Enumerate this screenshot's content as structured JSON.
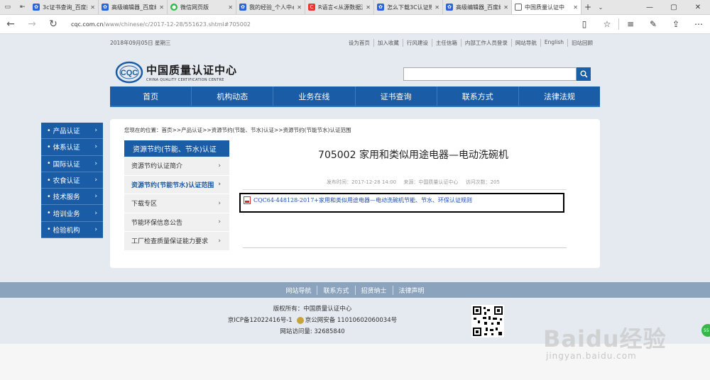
{
  "browser": {
    "tabs": [
      {
        "label": "3c证书查询_百度搜",
        "icon": "paw-icon",
        "active": false
      },
      {
        "label": "高级编辑器_百度经",
        "icon": "paw-icon",
        "active": false
      },
      {
        "label": "微信网页版",
        "icon": "wechat-icon",
        "active": false
      },
      {
        "label": "我的经验_个人中心",
        "icon": "paw-icon",
        "active": false
      },
      {
        "label": "R语言<从源数据流",
        "icon": "c-icon",
        "active": false
      },
      {
        "label": "怎么下载3C认证规",
        "icon": "paw-icon",
        "active": false
      },
      {
        "label": "高级编辑器_百度经",
        "icon": "paw-icon",
        "active": false
      },
      {
        "label": "中国质量认证中",
        "icon": "page-icon",
        "active": true
      }
    ],
    "url_domain": "cqc.com.cn",
    "url_path": "/www/chinese/c/2017-12-28/551623.shtml#705002"
  },
  "header": {
    "date": "2018年09月05日 星期三",
    "links": [
      "设为首页",
      "加入收藏",
      "行风建设",
      "主任信箱",
      "内部工作人员登录",
      "网站导航",
      "English",
      "旧站回顾"
    ],
    "logo_cn": "中国质量认证中心",
    "logo_en": "CHINA QUALITY CERTIFICATION CENTRE",
    "logo_mark": "CQC",
    "search_placeholder": ""
  },
  "mainnav": [
    "首页",
    "机构动态",
    "业务在线",
    "证书查询",
    "联系方式",
    "法律法规"
  ],
  "leftmenu": [
    "产品认证",
    "体系认证",
    "国际认证",
    "农食认证",
    "技术服务",
    "培训业务",
    "检验机构"
  ],
  "content": {
    "breadcrumb": "您现在的位置：首页>>产品认证>>资源节约(节能、节水)认证>>资源节约(节能节水)认证范围",
    "submenu_title": "资源节约(节能、节水)认证",
    "submenu_items": [
      {
        "label": "资源节约认证简介",
        "active": false
      },
      {
        "label": "资源节约(节能节水)认证范围",
        "active": true
      },
      {
        "label": "下载专区",
        "active": false
      },
      {
        "label": "节能环保信息公告",
        "active": false
      },
      {
        "label": "工厂检查质量保证能力要求",
        "active": false
      }
    ],
    "title": "705002 家用和类似用途电器—电动洗碗机",
    "meta_date": "发布时间：2017-12-28 14:00",
    "meta_source": "来源：中国质量认证中心",
    "meta_visits": "访问次数：205",
    "attachment": "CQC64-448128-2017+家用和类似用途电器—电动洗碗机节能、节水、环保认证规则"
  },
  "footer": {
    "links": [
      "网站导航",
      "联系方式",
      "招贤纳士",
      "法律声明"
    ],
    "copyright": "版权所有：中国质量认证中心",
    "icp": "京ICP备12022416号-1",
    "police": "京公网安备 11010602060034号",
    "visits": "网站访问量: 32685840"
  },
  "watermark": {
    "main": "Baidu经验",
    "url": "jingyan.baidu.com"
  },
  "colors": {
    "brand_blue": "#1b5ca6",
    "footer_bar": "#8ba3bd",
    "link_blue": "#1b4fb4"
  }
}
